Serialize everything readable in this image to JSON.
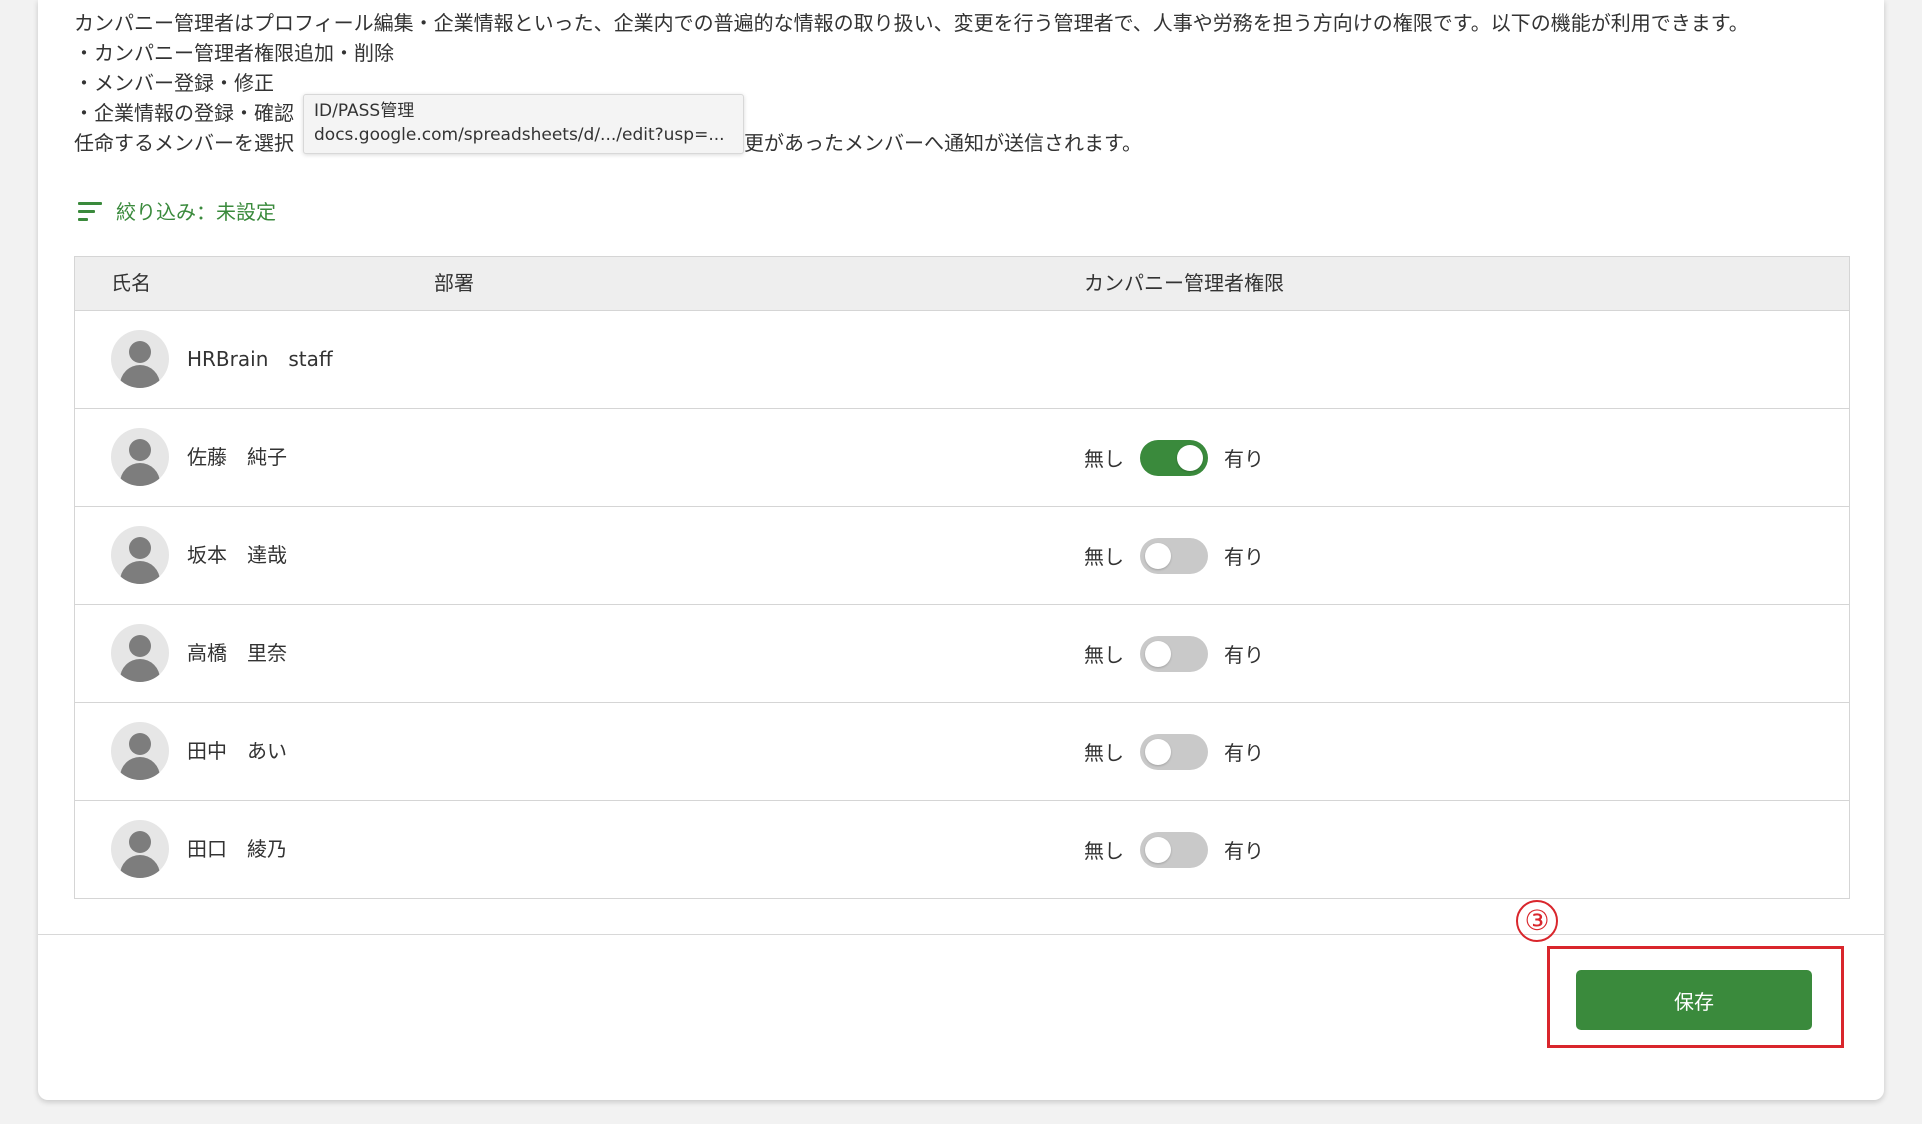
{
  "description": {
    "lines": [
      "カンパニー管理者はプロフィール編集・企業情報といった、企業内での普遍的な情報の取り扱い、変更を行う管理者で、人事や労務を担う方向けの権限です。以下の機能が利用できます。",
      "・カンパニー管理者権限追加・削除",
      "・メンバー登録・修正",
      "・企業情報の登録・確認",
      "任命するメンバーを選択",
      "更があったメンバーへ通知が送信されます。"
    ]
  },
  "tooltip": {
    "title": "ID/PASS管理",
    "url": "docs.google.com/spreadsheets/d/.../edit?usp=..."
  },
  "filter": {
    "label": "絞り込み：未設定",
    "icon": "filter-icon"
  },
  "table": {
    "headers": {
      "name": "氏名",
      "department": "部署",
      "permission": "カンパニー管理者権限"
    },
    "toggle_off_label": "無し",
    "toggle_on_label": "有り",
    "rows": [
      {
        "name": "HRBrain　staff",
        "department": "",
        "has_toggle": false,
        "enabled": false
      },
      {
        "name": "佐藤　純子",
        "department": "",
        "has_toggle": true,
        "enabled": true
      },
      {
        "name": "坂本　達哉",
        "department": "",
        "has_toggle": true,
        "enabled": false
      },
      {
        "name": "高橋　里奈",
        "department": "",
        "has_toggle": true,
        "enabled": false
      },
      {
        "name": "田中　あい",
        "department": "",
        "has_toggle": true,
        "enabled": false
      },
      {
        "name": "田口　綾乃",
        "department": "",
        "has_toggle": true,
        "enabled": false
      }
    ]
  },
  "annotation": {
    "step_number": "③"
  },
  "footer": {
    "save_label": "保存"
  },
  "colors": {
    "accent": "#3a8a3c",
    "annotation_red": "#d9262c",
    "toggle_off": "#c9c9c9"
  }
}
